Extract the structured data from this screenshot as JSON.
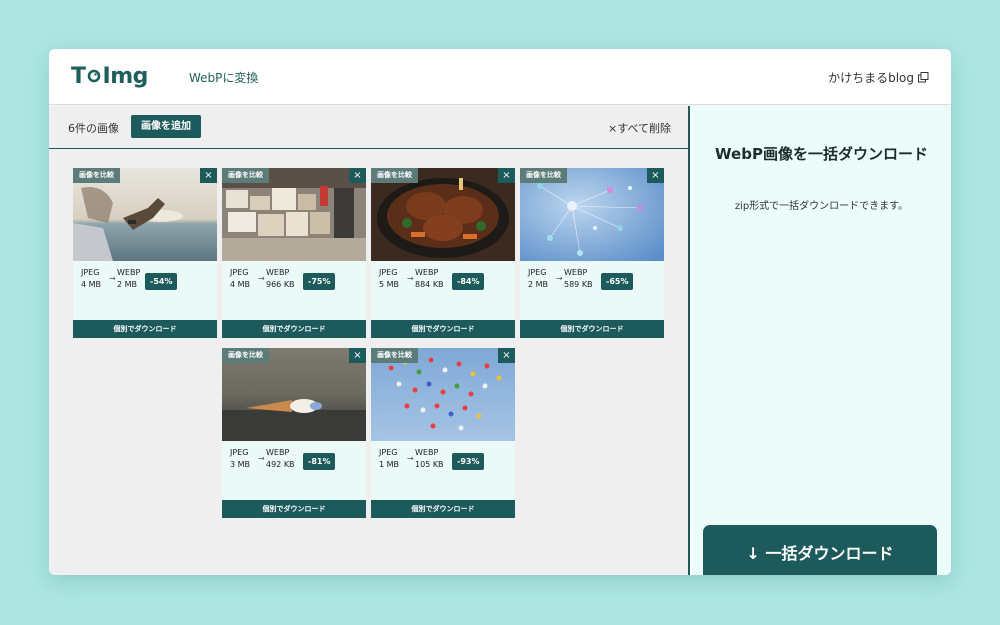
{
  "header": {
    "logo_text_left": "T",
    "logo_text_right": "Img",
    "nav_link": "WebPに変換",
    "blog_link": "かけちまるblog",
    "external_icon": "external-link-icon"
  },
  "toolbar": {
    "count_label": "6件の画像",
    "add_button": "画像を追加",
    "delete_all": "×すべて削除"
  },
  "card_labels": {
    "compare": "画像を比較",
    "close": "×",
    "download": "個別でダウンロード",
    "arrow": "→"
  },
  "cards": [
    {
      "from_format": "JPEG",
      "from_size": "4 MB",
      "to_format": "WEBP",
      "to_size": "2 MB",
      "reduction": "-54%",
      "image": "sunset-hand-ocean"
    },
    {
      "from_format": "JPEG",
      "from_size": "4 MB",
      "to_format": "WEBP",
      "to_size": "966 KB",
      "reduction": "-75%",
      "image": "warehouse-boxes"
    },
    {
      "from_format": "JPEG",
      "from_size": "5 MB",
      "to_format": "WEBP",
      "to_size": "884 KB",
      "reduction": "-84%",
      "image": "hamburg-steak-pan"
    },
    {
      "from_format": "JPEG",
      "from_size": "2 MB",
      "to_format": "WEBP",
      "to_size": "589 KB",
      "reduction": "-65%",
      "image": "crystal-molecules"
    },
    {
      "from_format": "JPEG",
      "from_size": "3 MB",
      "to_format": "WEBP",
      "to_size": "492 KB",
      "reduction": "-81%",
      "image": "dropped-ice-cream"
    },
    {
      "from_format": "JPEG",
      "from_size": "1 MB",
      "to_format": "WEBP",
      "to_size": "105 KB",
      "reduction": "-93%",
      "image": "balloons-sky"
    }
  ],
  "side": {
    "title": "WebP画像を一括ダウンロード",
    "description": "zip形式で一括ダウンロードできます。",
    "bulk_button": "↓ 一括ダウンロード"
  },
  "colors": {
    "accent": "#1d5a5c",
    "background": "#ade6e1",
    "card_bg": "#ebfaf7"
  }
}
